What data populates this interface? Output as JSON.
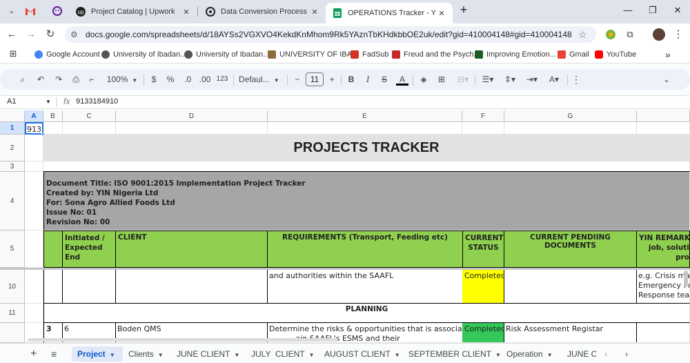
{
  "browser": {
    "tabs": [
      {
        "title": "Project Catalog | Upwork",
        "icon": "upwork-icon"
      },
      {
        "title": "Data Conversion Process",
        "icon": "openai-icon"
      },
      {
        "title": "OPERATIONS Tracker - YIN_202",
        "icon": "sheets-icon"
      }
    ],
    "url": "docs.google.com/spreadsheets/d/18AYSs2VGXVO4KekdKnMhom9Rk5YAznTbKHdkbbOE2uk/edit?gid=410004148#gid=410004148",
    "bookmarks": [
      {
        "label": "Google Account",
        "color": "#4285f4"
      },
      {
        "label": "University of Ibadan...",
        "color": "#555555"
      },
      {
        "label": "University of Ibadan...",
        "color": "#555555"
      },
      {
        "label": "UNIVERSITY OF IBA...",
        "color": "#8a6d3b"
      },
      {
        "label": "FadSub",
        "color": "#d93025"
      },
      {
        "label": "Freud and the Psych...",
        "color": "#c62828"
      },
      {
        "label": "Improving Emotion...",
        "color": "#1b5e20"
      },
      {
        "label": "Gmail",
        "color": "#ea4335"
      },
      {
        "label": "YouTube",
        "color": "#ff0000"
      }
    ],
    "more_bookmarks": "»"
  },
  "toolbar": {
    "zoom": "100%",
    "currency": "$",
    "percent": "%",
    "dec_decrease": ".0",
    "dec_increase": ".00",
    "number_format": "123",
    "font": "Defaul...",
    "font_size": "11",
    "minus": "−",
    "plus": "+",
    "bold": "B",
    "italic": "I",
    "strike": "S",
    "text_color": "A",
    "text_color_bar": "#000000",
    "more": "⋮"
  },
  "formula_bar": {
    "cell_ref": "A1",
    "fx": "fx",
    "value": "9133184910"
  },
  "grid": {
    "columns": [
      "A",
      "B",
      "C",
      "D",
      "E",
      "F",
      "G"
    ],
    "rows": [
      "1",
      "2",
      "3",
      "4",
      "5",
      "10",
      "11"
    ],
    "a1_value": "9133",
    "title": "PROJECTS TRACKER",
    "doc_info": [
      "Document Title: ISO 9001:2015 Implementation Project Tracker",
      "Created by: YIN Nigeria Ltd",
      "For: Sona Agro Allied Foods Ltd",
      "Issue No: 01",
      "Revision No: 00"
    ],
    "headers": {
      "initiated": "Initiated /\nExpected End",
      "client": "CLIENT",
      "requirements": "REQUIREMENTS (Transport, Feeding etc)",
      "status": "CURRENT\nSTATUS",
      "pending": "CURRENT PENDIING DOCUMENTS",
      "remark": "YIN REMARK(\njob, soluti\npro"
    },
    "row10": {
      "requirements": "and authorities within the SAAFL",
      "status": "Completed",
      "remark": "e.g. Crisis mar\nEmergency Pre\nResponse tean"
    },
    "section": "PLANNING",
    "row12": {
      "b": "3",
      "c": "6",
      "d": "Boden QMS",
      "requirements": "Determine the risks & opportunities that is associated with\n        ...ain SAAFL's ESMS and their",
      "status": "Completed",
      "pending": "Risk Assessment Registar"
    },
    "colors": {
      "header_green": "#8fd14f",
      "status_yellow": "#ffff00",
      "status_green": "#34c759",
      "info_gray": "#a6a6a6",
      "title_gray": "#e2e2e2"
    }
  },
  "sheet_tabs": {
    "tabs": [
      "Project",
      "Clients",
      "JUNE CLIENT",
      "JULY  CLIENT",
      "AUGUST CLIENT",
      "SEPTEMBER CLIENT",
      "Operation",
      "JUNE C"
    ]
  }
}
